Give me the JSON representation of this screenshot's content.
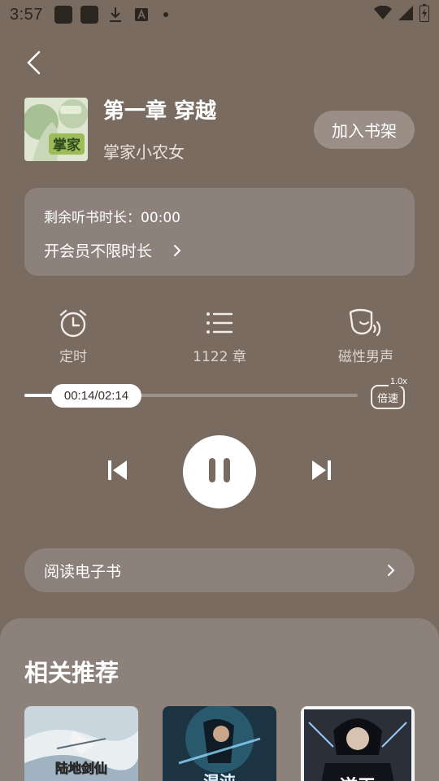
{
  "status_bar": {
    "time": "3:57",
    "icons": [
      "app-icon",
      "app-icon",
      "download-icon",
      "font-icon",
      "dot-icon",
      "wifi-icon",
      "signal-icon",
      "battery-icon"
    ]
  },
  "nav": {
    "back_icon": "chevron-left-icon"
  },
  "book": {
    "chapter_title": "第一章 穿越",
    "author": "掌家小农女",
    "cover_text": "掌家"
  },
  "actions": {
    "add_to_shelf": "加入书架"
  },
  "vip": {
    "remaining_label": "剩余听书时长：00:00",
    "upgrade_link": "开会员不限时长"
  },
  "functions": [
    {
      "icon": "alarm-clock-icon",
      "label": "定时"
    },
    {
      "icon": "chapter-list-icon",
      "label": "1122 章"
    },
    {
      "icon": "voice-icon",
      "label": "磁性男声"
    }
  ],
  "player": {
    "time_display": "00:14/02:14",
    "progress": 0.104,
    "speed_label": "倍速",
    "speed_value": "1.0x",
    "state": "playing"
  },
  "ebook": {
    "label": "阅读电子书"
  },
  "recommend": {
    "title": "相关推荐",
    "books": [
      {
        "cover_text": "陆地剑仙"
      },
      {
        "cover_text": "混沌"
      },
      {
        "cover_text": "逆天"
      }
    ]
  },
  "colors": {
    "background": "#7a6b61",
    "card": "#8d827b",
    "button": "#9a8e87"
  }
}
